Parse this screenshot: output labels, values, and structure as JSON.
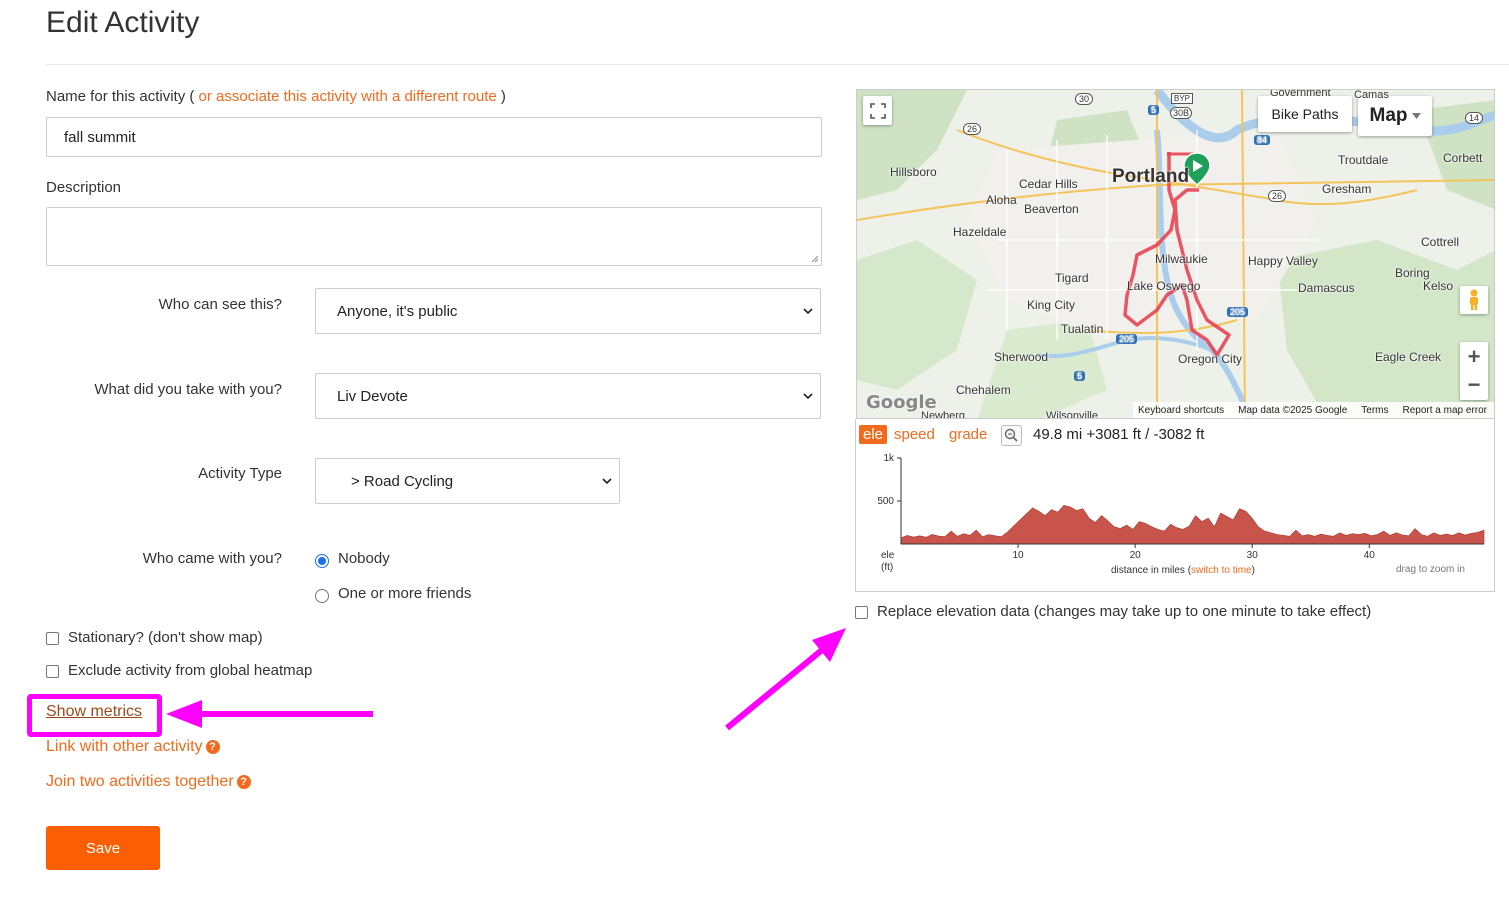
{
  "page": {
    "title": "Edit Activity"
  },
  "name_field": {
    "label_prefix": "Name for this activity (",
    "label_link": "or associate this activity with a different route",
    "label_suffix": ")",
    "value": "fall summit"
  },
  "description": {
    "label": "Description",
    "value": ""
  },
  "visibility": {
    "label": "Who can see this?",
    "selected": "Anyone, it's public"
  },
  "gear": {
    "label": "What did you take with you?",
    "selected": "Liv Devote"
  },
  "activity_type": {
    "label": "Activity Type",
    "selected": "> Road Cycling"
  },
  "companions": {
    "label": "Who came with you?",
    "options": [
      {
        "label": "Nobody",
        "checked": true
      },
      {
        "label": "One or more friends",
        "checked": false
      }
    ]
  },
  "checkboxes": {
    "stationary": "Stationary? (don't show map)",
    "exclude_heatmap": "Exclude activity from global heatmap",
    "replace_elevation": "Replace elevation data (changes may take up to one minute to take effect)"
  },
  "links": {
    "show_metrics": "Show metrics",
    "link_activity": "Link with other activity",
    "join_activities": "Join two activities together"
  },
  "save_label": "Save",
  "map": {
    "bike_paths": "Bike Paths",
    "map_type": "Map",
    "zoom_in": "+",
    "zoom_out": "−",
    "logo": "Google",
    "attribution": [
      "Keyboard shortcuts",
      "Map data ©2025 Google",
      "Terms",
      "Report a map error"
    ],
    "places": {
      "portland": "Portland",
      "hillsboro": "Hillsboro",
      "cedar_hills": "Cedar Hills",
      "aloha": "Aloha",
      "beaverton": "Beaverton",
      "hazeldale": "Hazeldale",
      "troutdale": "Troutdale",
      "corbett": "Corbett",
      "gresham": "Gresham",
      "cottrell": "Cottrell",
      "milwaukie": "Milwaukie",
      "happy_valley": "Happy Valley",
      "tigard": "Tigard",
      "boring": "Boring",
      "lake_oswego": "Lake Oswego",
      "damascus": "Damascus",
      "king_city": "King City",
      "kelso": "Kelso",
      "tualatin": "Tualatin",
      "sherwood": "Sherwood",
      "oregon_city": "Oregon City",
      "eagle_creek": "Eagle Creek",
      "chehalem": "Chehalem",
      "government": "Government",
      "camas": "Camas",
      "wilsonville": "Wilsonville",
      "newberg": "Newberg"
    },
    "shields": [
      "30",
      "26",
      "5",
      "BYP",
      "30B",
      "84",
      "26",
      "205",
      "205",
      "5",
      "14"
    ]
  },
  "elevation": {
    "tabs": [
      "ele",
      "speed",
      "grade"
    ],
    "active_tab": "ele",
    "stats": "49.8 mi +3081 ft / -3082 ft",
    "y_axis": {
      "label": "ele",
      "unit": "(ft)",
      "ticks": [
        "1k",
        "500"
      ]
    },
    "x_axis": {
      "label": "distance in miles",
      "switch": "switch to time",
      "open": "(",
      "close": ")",
      "ticks": [
        "10",
        "20",
        "30",
        "40"
      ]
    },
    "hint": "drag to zoom in",
    "profile_color": "#c9544b",
    "profile_ft": [
      72,
      100,
      80,
      95,
      78,
      110,
      92,
      85,
      150,
      90,
      120,
      100,
      160,
      85,
      110,
      95,
      85,
      140,
      210,
      280,
      350,
      420,
      380,
      330,
      400,
      370,
      450,
      430,
      390,
      410,
      300,
      250,
      330,
      270,
      200,
      180,
      220,
      170,
      260,
      240,
      200,
      170,
      150,
      230,
      190,
      170,
      210,
      330,
      260,
      300,
      200,
      360,
      320,
      280,
      410,
      380,
      300,
      200,
      150,
      130,
      110,
      100,
      90,
      160,
      95,
      110,
      90,
      115,
      100,
      90,
      130,
      100,
      120,
      110,
      125,
      95,
      110,
      150,
      100,
      130,
      105,
      95,
      180,
      110,
      90,
      130,
      100,
      115,
      100,
      130,
      105,
      125,
      135,
      160
    ]
  }
}
